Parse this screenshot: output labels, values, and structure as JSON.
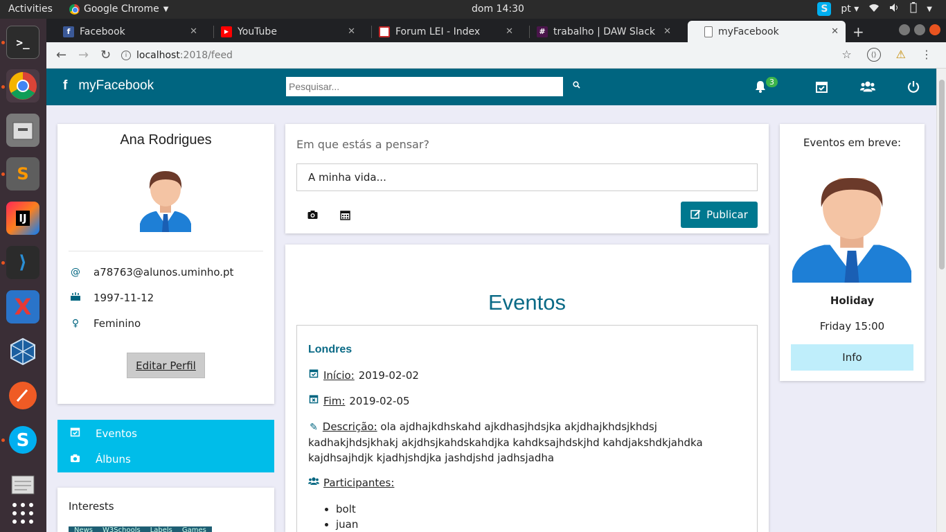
{
  "os": {
    "activities": "Activities",
    "app_name": "Google Chrome",
    "clock": "dom 14:30",
    "lang": "pt"
  },
  "browser": {
    "tabs": [
      {
        "label": "Facebook",
        "favicon": "facebook-icon"
      },
      {
        "label": "YouTube",
        "favicon": "youtube-icon"
      },
      {
        "label": "Forum LEI - Index",
        "favicon": "forum-icon"
      },
      {
        "label": "trabalho | DAW Slack",
        "favicon": "slack-icon"
      },
      {
        "label": "myFacebook",
        "favicon": "page-icon",
        "active": true
      }
    ],
    "url_host": "localhost",
    "url_rest": ":2018/feed"
  },
  "navbar": {
    "brand": "myFacebook",
    "search_placeholder": "Pesquisar...",
    "notifications_count": "3",
    "color": "#006580"
  },
  "profile": {
    "name": "Ana Rodrigues",
    "email": "a78763@alunos.uminho.pt",
    "birthdate": "1997-11-12",
    "gender": "Feminino",
    "edit_label": "Editar Perfil"
  },
  "side_menu": {
    "items": [
      {
        "label": "Eventos",
        "icon": "calendar-check-icon"
      },
      {
        "label": "Álbuns",
        "icon": "camera-icon"
      }
    ],
    "color": "#00bde9"
  },
  "interests": {
    "title": "Interests",
    "tags": [
      "News",
      "W3Schools",
      "Labels",
      "Games"
    ]
  },
  "composer": {
    "prompt": "Em que estás a pensar?",
    "value": "A minha vida...",
    "publish_label": "Publicar"
  },
  "events": {
    "heading": "Eventos",
    "item": {
      "name": "Londres",
      "start_label": "Início:",
      "start": "2019-02-02",
      "end_label": "Fim:",
      "end": "2019-02-05",
      "desc_label": "Descrição:",
      "description": "ola ajdhajkdhskahd ajkdhasjhdsjka akjdhajkhdsjkhdsj kadhakjhdsjkhakj akjdhsjkahdskahdjka kahdksajhdskjhd kahdjakshdkjahdka kajdhsajhdjk kjadhjshdjka jashdjshd jadhsjadha",
      "participants_label": "Participantes:",
      "participants": [
        "bolt",
        "juan"
      ]
    }
  },
  "upcoming": {
    "title": "Eventos em breve:",
    "event_name": "Holiday",
    "event_time": "Friday 15:00",
    "info_label": "Info"
  }
}
